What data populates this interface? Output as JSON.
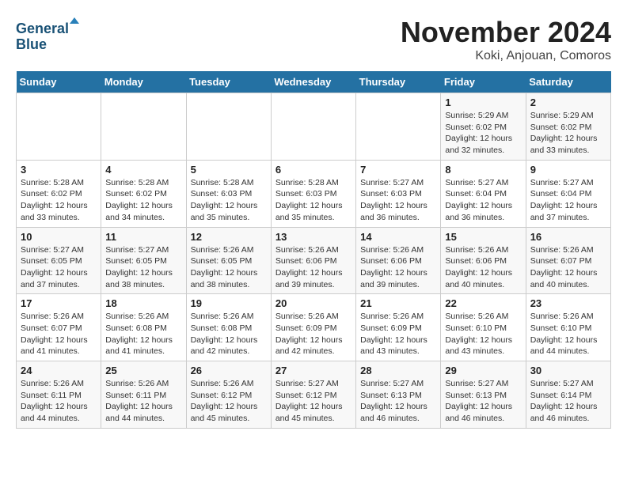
{
  "header": {
    "logo_line1": "General",
    "logo_line2": "Blue",
    "month": "November 2024",
    "location": "Koki, Anjouan, Comoros"
  },
  "weekdays": [
    "Sunday",
    "Monday",
    "Tuesday",
    "Wednesday",
    "Thursday",
    "Friday",
    "Saturday"
  ],
  "weeks": [
    [
      {
        "day": "",
        "info": ""
      },
      {
        "day": "",
        "info": ""
      },
      {
        "day": "",
        "info": ""
      },
      {
        "day": "",
        "info": ""
      },
      {
        "day": "",
        "info": ""
      },
      {
        "day": "1",
        "info": "Sunrise: 5:29 AM\nSunset: 6:02 PM\nDaylight: 12 hours\nand 32 minutes."
      },
      {
        "day": "2",
        "info": "Sunrise: 5:29 AM\nSunset: 6:02 PM\nDaylight: 12 hours\nand 33 minutes."
      }
    ],
    [
      {
        "day": "3",
        "info": "Sunrise: 5:28 AM\nSunset: 6:02 PM\nDaylight: 12 hours\nand 33 minutes."
      },
      {
        "day": "4",
        "info": "Sunrise: 5:28 AM\nSunset: 6:02 PM\nDaylight: 12 hours\nand 34 minutes."
      },
      {
        "day": "5",
        "info": "Sunrise: 5:28 AM\nSunset: 6:03 PM\nDaylight: 12 hours\nand 35 minutes."
      },
      {
        "day": "6",
        "info": "Sunrise: 5:28 AM\nSunset: 6:03 PM\nDaylight: 12 hours\nand 35 minutes."
      },
      {
        "day": "7",
        "info": "Sunrise: 5:27 AM\nSunset: 6:03 PM\nDaylight: 12 hours\nand 36 minutes."
      },
      {
        "day": "8",
        "info": "Sunrise: 5:27 AM\nSunset: 6:04 PM\nDaylight: 12 hours\nand 36 minutes."
      },
      {
        "day": "9",
        "info": "Sunrise: 5:27 AM\nSunset: 6:04 PM\nDaylight: 12 hours\nand 37 minutes."
      }
    ],
    [
      {
        "day": "10",
        "info": "Sunrise: 5:27 AM\nSunset: 6:05 PM\nDaylight: 12 hours\nand 37 minutes."
      },
      {
        "day": "11",
        "info": "Sunrise: 5:27 AM\nSunset: 6:05 PM\nDaylight: 12 hours\nand 38 minutes."
      },
      {
        "day": "12",
        "info": "Sunrise: 5:26 AM\nSunset: 6:05 PM\nDaylight: 12 hours\nand 38 minutes."
      },
      {
        "day": "13",
        "info": "Sunrise: 5:26 AM\nSunset: 6:06 PM\nDaylight: 12 hours\nand 39 minutes."
      },
      {
        "day": "14",
        "info": "Sunrise: 5:26 AM\nSunset: 6:06 PM\nDaylight: 12 hours\nand 39 minutes."
      },
      {
        "day": "15",
        "info": "Sunrise: 5:26 AM\nSunset: 6:06 PM\nDaylight: 12 hours\nand 40 minutes."
      },
      {
        "day": "16",
        "info": "Sunrise: 5:26 AM\nSunset: 6:07 PM\nDaylight: 12 hours\nand 40 minutes."
      }
    ],
    [
      {
        "day": "17",
        "info": "Sunrise: 5:26 AM\nSunset: 6:07 PM\nDaylight: 12 hours\nand 41 minutes."
      },
      {
        "day": "18",
        "info": "Sunrise: 5:26 AM\nSunset: 6:08 PM\nDaylight: 12 hours\nand 41 minutes."
      },
      {
        "day": "19",
        "info": "Sunrise: 5:26 AM\nSunset: 6:08 PM\nDaylight: 12 hours\nand 42 minutes."
      },
      {
        "day": "20",
        "info": "Sunrise: 5:26 AM\nSunset: 6:09 PM\nDaylight: 12 hours\nand 42 minutes."
      },
      {
        "day": "21",
        "info": "Sunrise: 5:26 AM\nSunset: 6:09 PM\nDaylight: 12 hours\nand 43 minutes."
      },
      {
        "day": "22",
        "info": "Sunrise: 5:26 AM\nSunset: 6:10 PM\nDaylight: 12 hours\nand 43 minutes."
      },
      {
        "day": "23",
        "info": "Sunrise: 5:26 AM\nSunset: 6:10 PM\nDaylight: 12 hours\nand 44 minutes."
      }
    ],
    [
      {
        "day": "24",
        "info": "Sunrise: 5:26 AM\nSunset: 6:11 PM\nDaylight: 12 hours\nand 44 minutes."
      },
      {
        "day": "25",
        "info": "Sunrise: 5:26 AM\nSunset: 6:11 PM\nDaylight: 12 hours\nand 44 minutes."
      },
      {
        "day": "26",
        "info": "Sunrise: 5:26 AM\nSunset: 6:12 PM\nDaylight: 12 hours\nand 45 minutes."
      },
      {
        "day": "27",
        "info": "Sunrise: 5:27 AM\nSunset: 6:12 PM\nDaylight: 12 hours\nand 45 minutes."
      },
      {
        "day": "28",
        "info": "Sunrise: 5:27 AM\nSunset: 6:13 PM\nDaylight: 12 hours\nand 46 minutes."
      },
      {
        "day": "29",
        "info": "Sunrise: 5:27 AM\nSunset: 6:13 PM\nDaylight: 12 hours\nand 46 minutes."
      },
      {
        "day": "30",
        "info": "Sunrise: 5:27 AM\nSunset: 6:14 PM\nDaylight: 12 hours\nand 46 minutes."
      }
    ]
  ]
}
